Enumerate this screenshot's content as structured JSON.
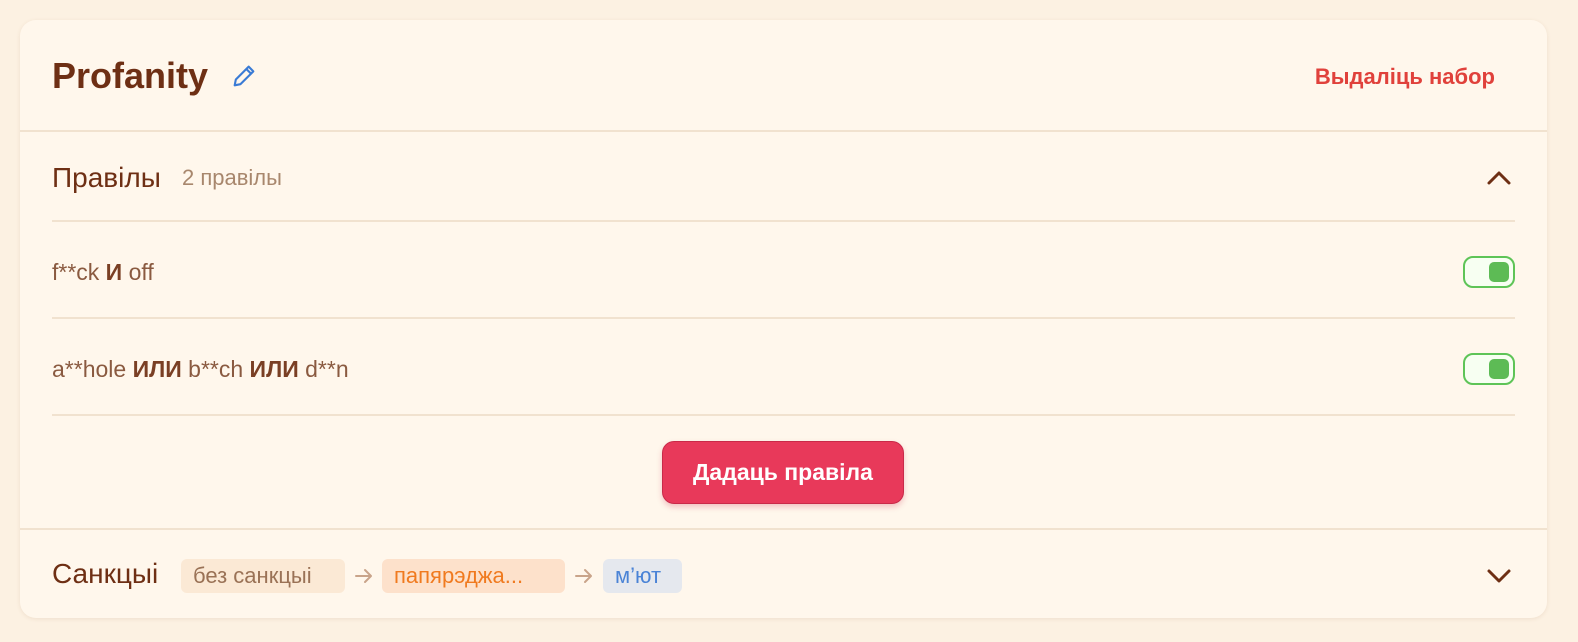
{
  "set": {
    "title": "Profanity",
    "edit_icon": "pencil-icon",
    "delete_label": "Выдаліць набор"
  },
  "rules": {
    "title": "Правілы",
    "count": "2 правілы",
    "collapse_icon": "chevron-up-icon",
    "items": [
      {
        "parts": [
          "f**ck",
          " И ",
          "off"
        ],
        "enabled": true
      },
      {
        "parts": [
          "a**hole",
          " ИЛИ ",
          "b**ch",
          " ИЛИ ",
          "d**n"
        ],
        "enabled": true
      }
    ],
    "add_label": "Дадаць правіла"
  },
  "sanctions": {
    "title": "Санкцыі",
    "steps": [
      "без санкцыі",
      "папярэджа...",
      "м’ют"
    ],
    "expand_icon": "chevron-down-icon"
  },
  "colors": {
    "accent": "#e8395a",
    "delete": "#e0413b",
    "toggle_on": "#5dbb55",
    "title": "#6e2f14"
  }
}
